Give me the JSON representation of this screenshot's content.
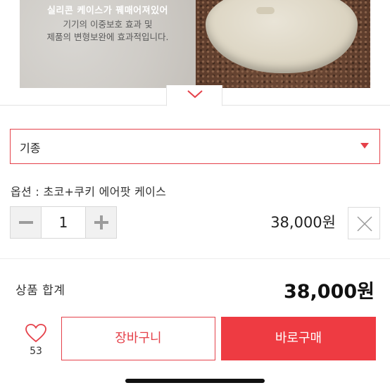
{
  "product_image": {
    "caption_line1": "실리콘 케이스가 꿰매어져있어",
    "caption_line2": "기기의 이중보호 효과 및",
    "caption_line3": "제품의 변형보완에 효과적입니다."
  },
  "collapse_icon": "chevron-down-icon",
  "model_select": {
    "value": "기종",
    "icon": "triangle-down-icon"
  },
  "option": {
    "label": "옵션 : 초코+쿠키 에어팟 케이스",
    "quantity": "1",
    "price": "38,000원",
    "remove_icon": "close-icon"
  },
  "total": {
    "label": "상품 합계",
    "price": "38,000원"
  },
  "bottom_bar": {
    "like_icon": "heart-icon",
    "like_count": "53",
    "cart_label": "장바구니",
    "buy_label": "바로구매"
  },
  "colors": {
    "accent": "#ee3b42",
    "border_accent": "#e5414a"
  }
}
